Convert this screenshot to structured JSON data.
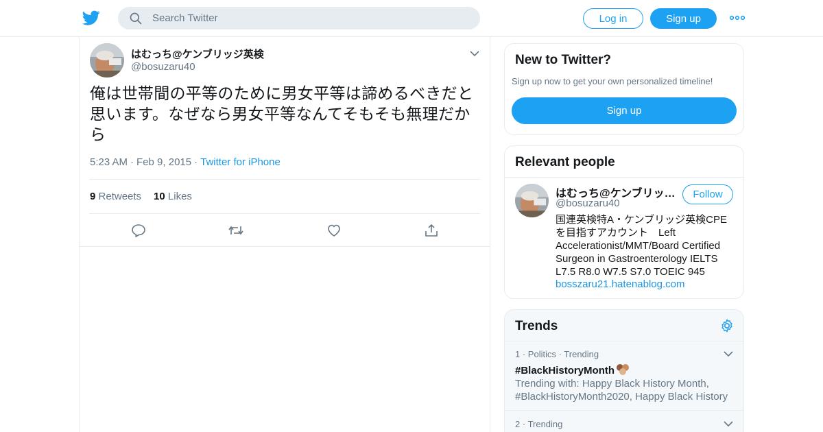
{
  "header": {
    "logo_icon": "twitter-bird-icon",
    "search_placeholder": "Search Twitter",
    "login_label": "Log in",
    "signup_label": "Sign up",
    "more_icon": "more-dots-icon"
  },
  "tweet": {
    "display_name": "はむっち@ケンブリッジ英検",
    "handle": "@bosuzaru40",
    "text": "俺は世帯間の平等のために男女平等は諦めるべきだと思います。なぜなら男女平等なんてそもそも無理だから",
    "time": "5:23 AM",
    "date": "Feb 9, 2015",
    "source": "Twitter for iPhone",
    "retweets_count": "9",
    "retweets_label": "Retweets",
    "likes_count": "10",
    "likes_label": "Likes"
  },
  "new_to_twitter": {
    "title": "New to Twitter?",
    "subtitle": "Sign up now to get your own personalized timeline!",
    "button": "Sign up"
  },
  "relevant_people": {
    "title": "Relevant people",
    "name": "はむっち@ケンブリッジ英検",
    "handle": "@bosuzaru40",
    "follow_label": "Follow",
    "bio": "国連英検特A・ケンブリッジ英検CPEを目指すアカウント　Left Accelerationist/MMT/Board Certified Surgeon in Gastroenterology IELTS L7.5 R8.0 W7.5 S7.0 TOEIC 945",
    "link": "bosszaru21.hatenablog.com"
  },
  "trends": {
    "title": "Trends",
    "items": [
      {
        "rank": "1",
        "category": "Politics",
        "status": "Trending",
        "name": "#BlackHistoryMonth",
        "with": "Trending with: Happy Black History Month, #BlackHistoryMonth2020, Happy Black History"
      },
      {
        "rank": "2",
        "status": "Trending"
      }
    ]
  },
  "colors": {
    "brand_blue": "#1da1f2",
    "link_blue": "#1b95e0",
    "secondary_text": "#657786",
    "border": "#e6ecf0"
  }
}
